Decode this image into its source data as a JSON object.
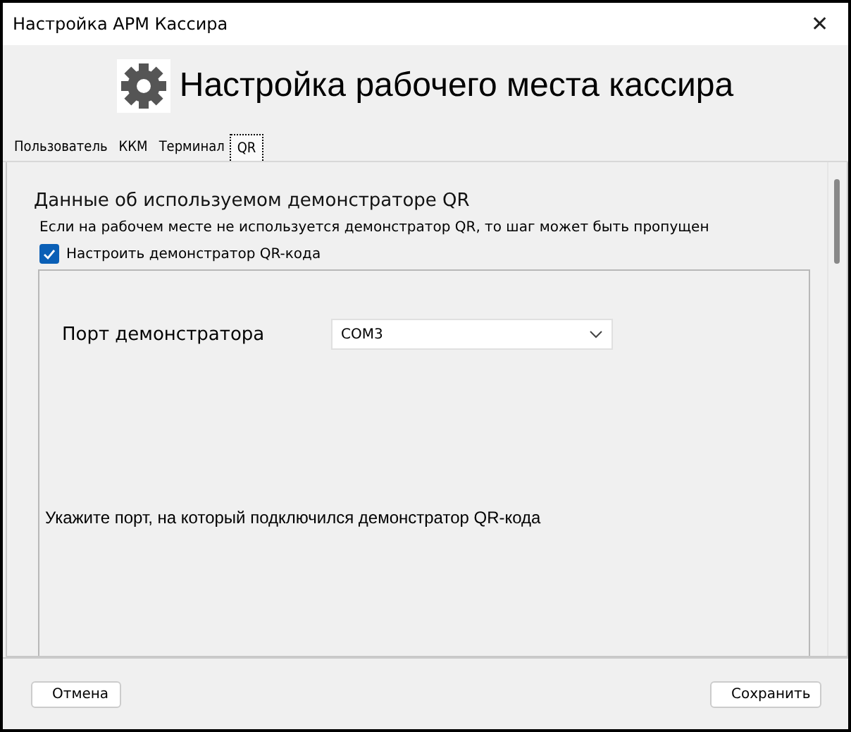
{
  "window": {
    "title": "Настройка АРМ Кассира",
    "close": "✕"
  },
  "header": {
    "title": "Настройка рабочего места кассира"
  },
  "tabs": [
    {
      "label": "Пользователь",
      "selected": false
    },
    {
      "label": "ККМ",
      "selected": false
    },
    {
      "label": "Терминал",
      "selected": false
    },
    {
      "label": "QR",
      "selected": true
    }
  ],
  "section": {
    "title": "Данные об используемом демонстраторе QR",
    "note": "Если на рабочем месте не используется демонстратор QR, то шаг может быть пропущен",
    "checkbox": {
      "label": "Настроить демонстратор QR-кода",
      "checked": true
    },
    "port": {
      "label": "Порт демонстратора",
      "value": "COM3"
    },
    "hint": "Укажите порт, на который подключился демонстратор QR-кода"
  },
  "buttons": {
    "cancel": "Отмена",
    "save": "Сохранить"
  }
}
